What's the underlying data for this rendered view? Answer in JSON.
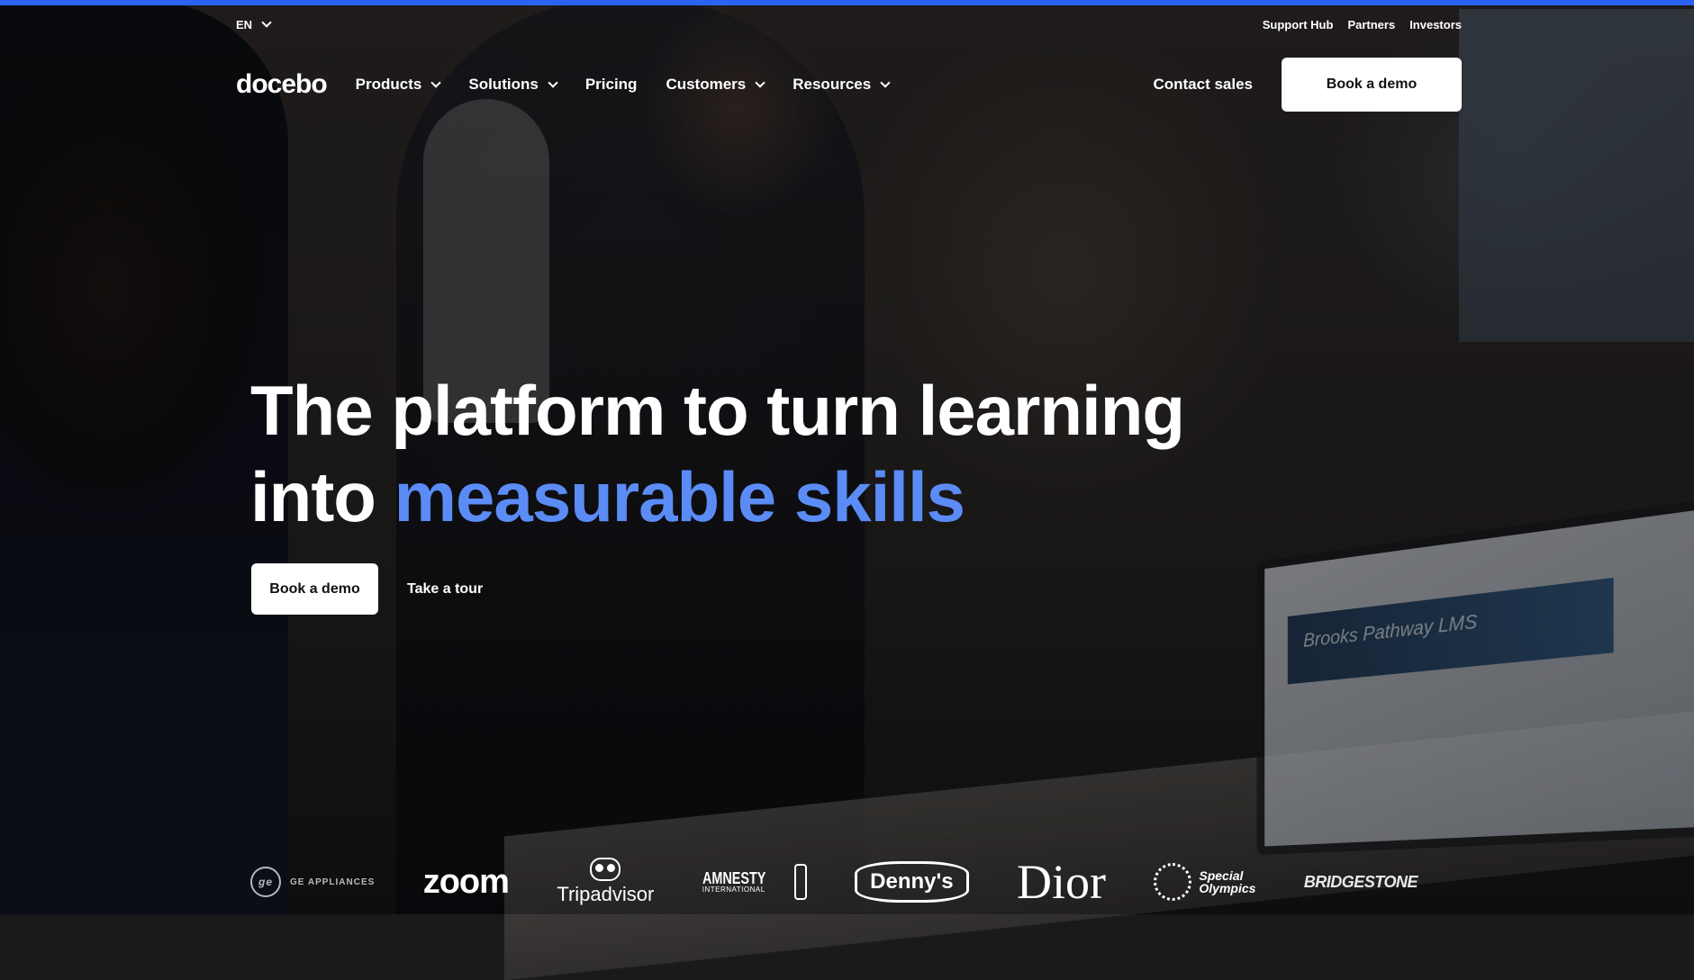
{
  "utility": {
    "lang": "EN",
    "links": [
      "Support Hub",
      "Partners",
      "Investors"
    ]
  },
  "nav": {
    "logo": "docebo",
    "items": [
      "Products",
      "Solutions",
      "Pricing",
      "Customers",
      "Resources"
    ],
    "contact_sales": "Contact sales",
    "book_demo": "Book a demo"
  },
  "hero": {
    "headline_line1": "The platform to turn learning",
    "headline_into": "into",
    "headline_accent": "measurable skills",
    "cta_primary": "Book a demo",
    "cta_secondary": "Take a tour",
    "laptop_banner": "Brooks Pathway LMS"
  },
  "customer_logos": {
    "ge": "GE APPLIANCES",
    "zoom": "zoom",
    "tripadvisor": "Tripadvisor",
    "amnesty_main": "AMNESTY",
    "amnesty_sub": "INTERNATIONAL",
    "dennys": "Denny's",
    "dior": "Dior",
    "special": "Special",
    "olympics": "Olympics",
    "bridgestone": "BRIDGESTONE"
  },
  "colors": {
    "accent_bar": "#2a63f6",
    "headline_accent": "#5b8cf6",
    "button_bg": "#ffffff"
  }
}
